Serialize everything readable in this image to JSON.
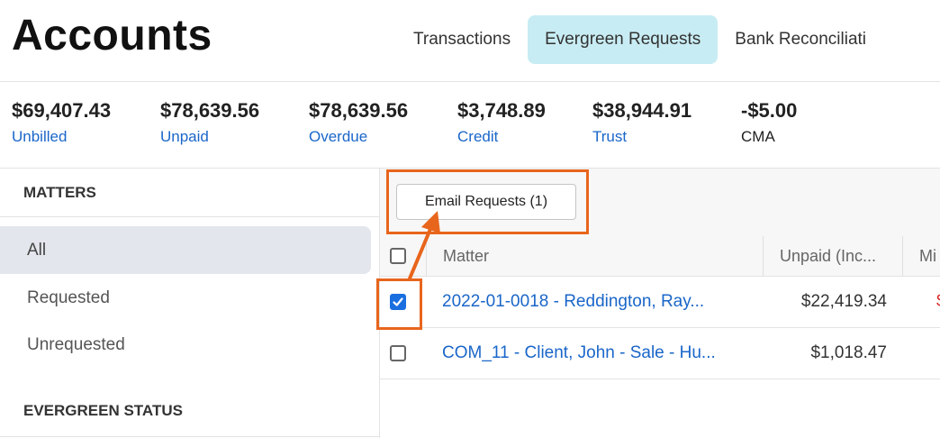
{
  "header": {
    "title": "Accounts",
    "tabs": [
      {
        "label": "Transactions",
        "active": false
      },
      {
        "label": "Evergreen Requests",
        "active": true
      },
      {
        "label": "Bank Reconciliati",
        "active": false
      }
    ]
  },
  "stats": [
    {
      "amount": "$69,407.43",
      "label": "Unbilled"
    },
    {
      "amount": "$78,639.56",
      "label": "Unpaid"
    },
    {
      "amount": "$78,639.56",
      "label": "Overdue"
    },
    {
      "amount": "$3,748.89",
      "label": "Credit"
    },
    {
      "amount": "$38,944.91",
      "label": "Trust"
    },
    {
      "amount": "-$5.00",
      "label": "CMA"
    }
  ],
  "sidebar": {
    "matters_heading": "MATTERS",
    "items": [
      {
        "label": "All",
        "active": true
      },
      {
        "label": "Requested",
        "active": false
      },
      {
        "label": "Unrequested",
        "active": false
      }
    ],
    "status_heading": "EVERGREEN STATUS"
  },
  "toolbar": {
    "email_label": "Email Requests (1)"
  },
  "table": {
    "columns": [
      "Matter",
      "Unpaid (Inc...",
      "Mi"
    ],
    "rows": [
      {
        "matter": "2022-01-0018 - Reddington, Ray...",
        "unpaid": "$22,419.34",
        "extra": "$",
        "checked": true
      },
      {
        "matter": "COM_11 - Client, John - Sale - Hu...",
        "unpaid": "$1,018.47",
        "extra": "",
        "checked": false
      }
    ]
  },
  "colors": {
    "accent": "#1a66c9",
    "highlight": "#e8651c",
    "active_tab": "#c8ecf3"
  }
}
